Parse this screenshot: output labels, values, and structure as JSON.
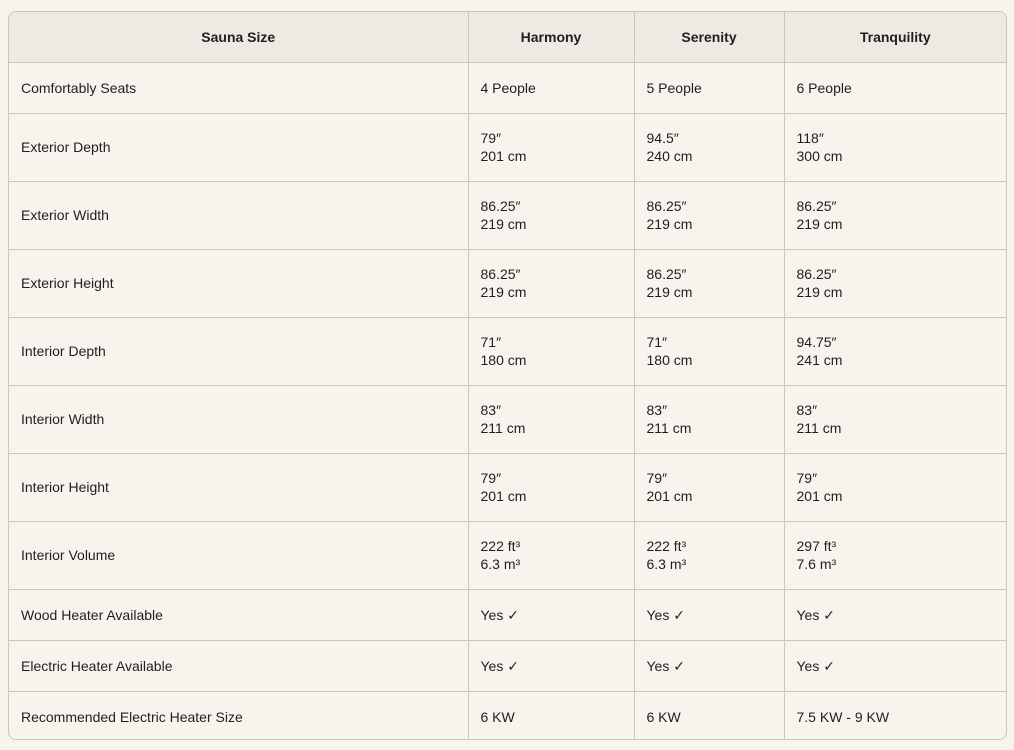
{
  "table": {
    "headers": [
      "Sauna Size",
      "Harmony",
      "Serenity",
      "Tranquility"
    ],
    "rows": [
      {
        "label": "Comfortably Seats",
        "cells": [
          [
            "4 People"
          ],
          [
            "5 People"
          ],
          [
            "6 People"
          ]
        ]
      },
      {
        "label": "Exterior Depth",
        "cells": [
          [
            "79″",
            "201 cm"
          ],
          [
            "94.5″",
            "240 cm"
          ],
          [
            "118″",
            "300 cm"
          ]
        ]
      },
      {
        "label": "Exterior Width",
        "cells": [
          [
            "86.25″",
            "219 cm"
          ],
          [
            "86.25″",
            "219 cm"
          ],
          [
            "86.25″",
            "219 cm"
          ]
        ]
      },
      {
        "label": "Exterior Height",
        "cells": [
          [
            "86.25″",
            "219 cm"
          ],
          [
            "86.25″",
            "219 cm"
          ],
          [
            "86.25″",
            "219 cm"
          ]
        ]
      },
      {
        "label": "Interior Depth",
        "cells": [
          [
            "71″",
            "180 cm"
          ],
          [
            "71″",
            "180 cm"
          ],
          [
            "94.75″",
            "241 cm"
          ]
        ]
      },
      {
        "label": "Interior Width",
        "cells": [
          [
            "83″",
            "211 cm"
          ],
          [
            "83″",
            "211 cm"
          ],
          [
            "83″",
            "211 cm"
          ]
        ]
      },
      {
        "label": "Interior Height",
        "cells": [
          [
            "79″",
            "201 cm"
          ],
          [
            "79″",
            "201 cm"
          ],
          [
            "79″",
            "201 cm"
          ]
        ]
      },
      {
        "label": "Interior Volume",
        "cells": [
          [
            "222 ft³",
            "6.3 m³"
          ],
          [
            "222 ft³",
            "6.3 m³"
          ],
          [
            "297 ft³",
            "7.6 m³"
          ]
        ]
      },
      {
        "label": "Wood Heater Available",
        "cells": [
          [
            "Yes ✓"
          ],
          [
            "Yes ✓"
          ],
          [
            "Yes ✓"
          ]
        ]
      },
      {
        "label": "Electric Heater Available",
        "cells": [
          [
            "Yes ✓"
          ],
          [
            "Yes ✓"
          ],
          [
            "Yes ✓"
          ]
        ]
      },
      {
        "label": "Recommended Electric Heater Size",
        "cells": [
          [
            "6 KW"
          ],
          [
            "6 KW"
          ],
          [
            "7.5 KW - 9 KW"
          ]
        ]
      }
    ]
  },
  "colors": {
    "background": "#f7f4ee",
    "header_background": "#edeae4",
    "border": "#c9c6c0",
    "text": "#1f1f1f"
  }
}
